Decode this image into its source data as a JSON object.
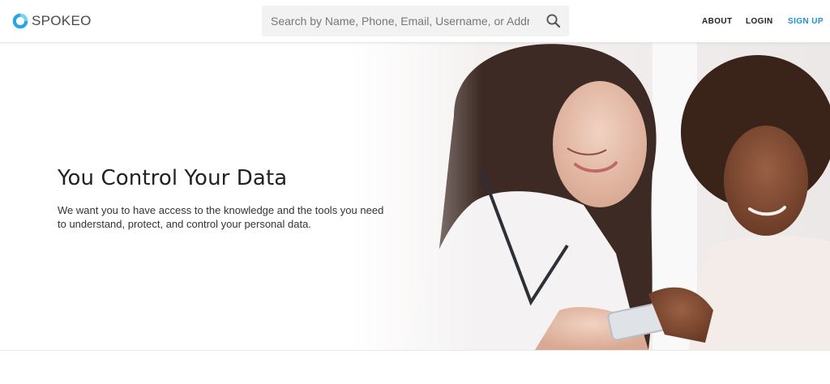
{
  "header": {
    "logo_text": "SPOKEO",
    "search": {
      "placeholder": "Search by Name, Phone, Email, Username, or Address",
      "value": ""
    },
    "nav": {
      "about": "ABOUT",
      "login": "LOGIN",
      "signup": "SIGN UP"
    }
  },
  "hero": {
    "title": "You Control Your Data",
    "description": "We want you to have access to the knowledge and the tools you need to understand, protect, and control your personal data."
  },
  "colors": {
    "brand_blue": "#1a91d8",
    "logo_blue": "#27a6e1",
    "search_bg": "#f2f2f2",
    "text_dark": "#222222"
  },
  "icons": {
    "logo": "spokeo-logo-icon",
    "search": "search-icon"
  }
}
